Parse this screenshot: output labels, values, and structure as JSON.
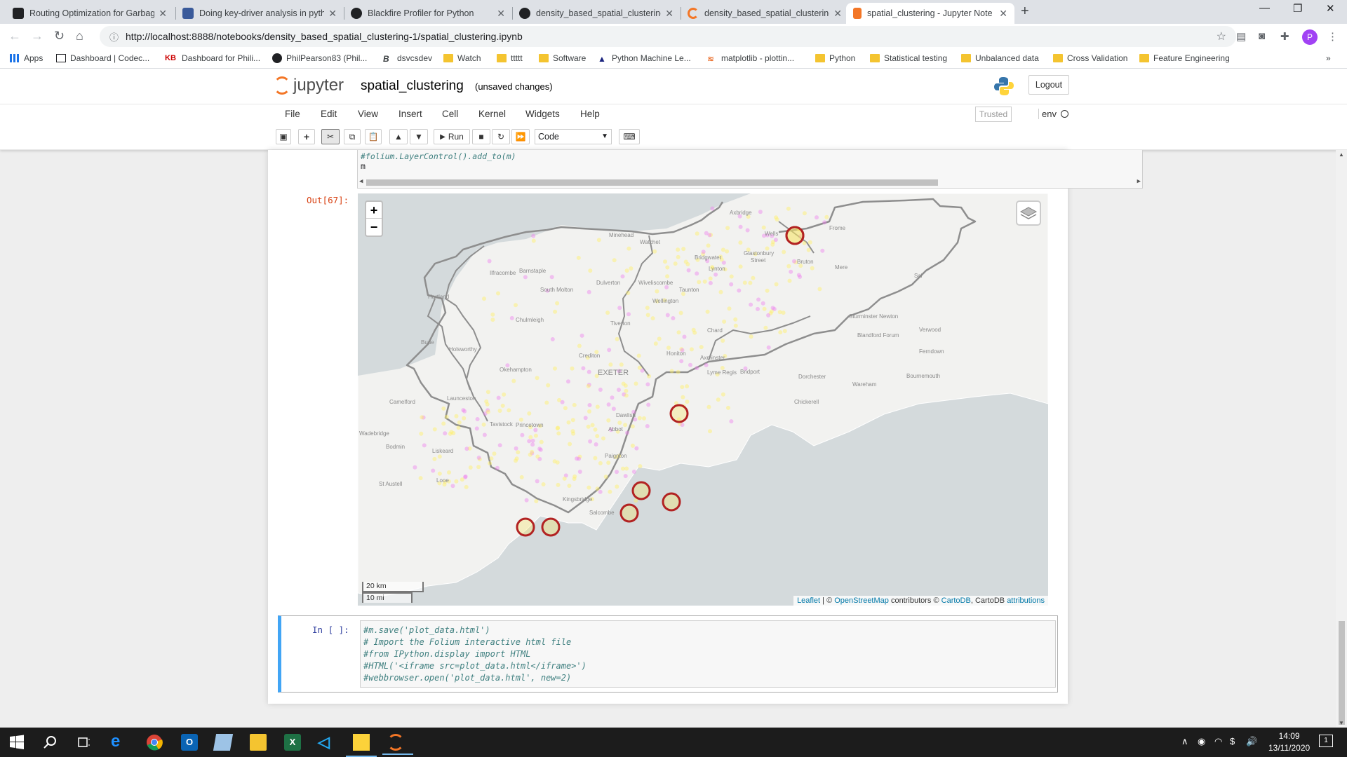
{
  "browser": {
    "tabs": [
      {
        "title": "Routing Optimization for Garbag",
        "icon_color": "#202124"
      },
      {
        "title": "Doing key-driver analysis in pyth",
        "icon_color": "#3a5a9a"
      },
      {
        "title": "Blackfire Profiler for Python",
        "icon_color": "#202124"
      },
      {
        "title": "density_based_spatial_clustering",
        "icon_color": "#202124"
      },
      {
        "title": "density_based_spatial_clustering",
        "icon_color": "#f37626"
      },
      {
        "title": "spatial_clustering - Jupyter Note",
        "icon_color": "#f37626",
        "active": true
      }
    ],
    "url": "http://localhost:8888/notebooks/density_based_spatial_clustering-1/spatial_clustering.ipynb",
    "profile_initial": "P",
    "bookmarks": [
      "Apps",
      "Dashboard | Codec...",
      "Dashboard for Phili...",
      "PhilPearson83 (Phil...",
      "dsvcsdev",
      "Watch",
      "ttttt",
      "Software",
      "Python Machine Le...",
      "matplotlib - plottin...",
      "Python",
      "Statistical testing",
      "Unbalanced data",
      "Cross Validation",
      "Feature Engineering"
    ],
    "bookmarks_more": "»"
  },
  "jupyter": {
    "logo_text": "jupyter",
    "notebook_title": "spatial_clustering",
    "save_status": "(unsaved changes)",
    "logout_label": "Logout",
    "menu": [
      "File",
      "Edit",
      "View",
      "Insert",
      "Cell",
      "Kernel",
      "Widgets",
      "Help"
    ],
    "trusted_label": "Trusted",
    "kernel_name": "env",
    "run_label": "Run",
    "cell_type": "Code"
  },
  "cells": {
    "prev_code_lines": [
      "#folium.LayerControl().add_to(m)",
      "m"
    ],
    "out_prompt": "Out[67]:",
    "in_prompt": "In [ ]:",
    "input_code_lines": [
      "#m.save('plot_data.html')",
      "# Import the Folium interactive html file",
      "#from IPython.display import HTML",
      "#HTML('<iframe src=plot_data.html</iframe>')",
      "#webbrowser.open('plot_data.html', new=2)"
    ]
  },
  "map": {
    "zoom_in": "+",
    "zoom_out": "−",
    "scale_km": "20 km",
    "scale_mi": "10 mi",
    "attribution": {
      "leaflet": "Leaflet",
      "sep": " | © ",
      "osm": "OpenStreetMap",
      "contrib": " contributors © ",
      "carto": "CartoDB",
      "rest": ", CartoDB ",
      "attr": "attributions"
    },
    "place_labels": [
      "Axbridge",
      "Wells",
      "Frome",
      "Minehead",
      "Watchet",
      "Glastonbury",
      "Street",
      "Bridgwater",
      "Bruton",
      "Mere",
      "Lynton",
      "Ilfracombe",
      "Barnstaple",
      "Dulverton",
      "Wiveliscombe",
      "Taunton",
      "Hartland",
      "South Molton",
      "Wellington",
      "Sturminster Newton",
      "Chulmleigh",
      "Tiverton",
      "Chard",
      "Blandford Forum",
      "Verwood",
      "Bude",
      "Holsworthy",
      "Crediton",
      "Honiton",
      "Axminster",
      "Ferndown",
      "Okehampton",
      "EXETER",
      "Lyme Regis",
      "Bridport",
      "Dorchester",
      "Wareham",
      "Bournemouth",
      "Launceston",
      "Camelford",
      "Tavistock",
      "Princetown",
      "Dawlish",
      "Chickerell",
      "Wadebridge",
      "Bodmin",
      "Liskeard",
      "Abbot",
      "Paignton",
      "St Austell",
      "Looe",
      "Kingsbridge",
      "Salcombe",
      "Sal"
    ],
    "cluster_markers": 8,
    "marker_color": "#b22222",
    "point_colors": [
      "#ee82ee",
      "#ffef66"
    ]
  },
  "taskbar": {
    "time": "14:09",
    "date": "13/11/2020",
    "notification_count": "1"
  }
}
